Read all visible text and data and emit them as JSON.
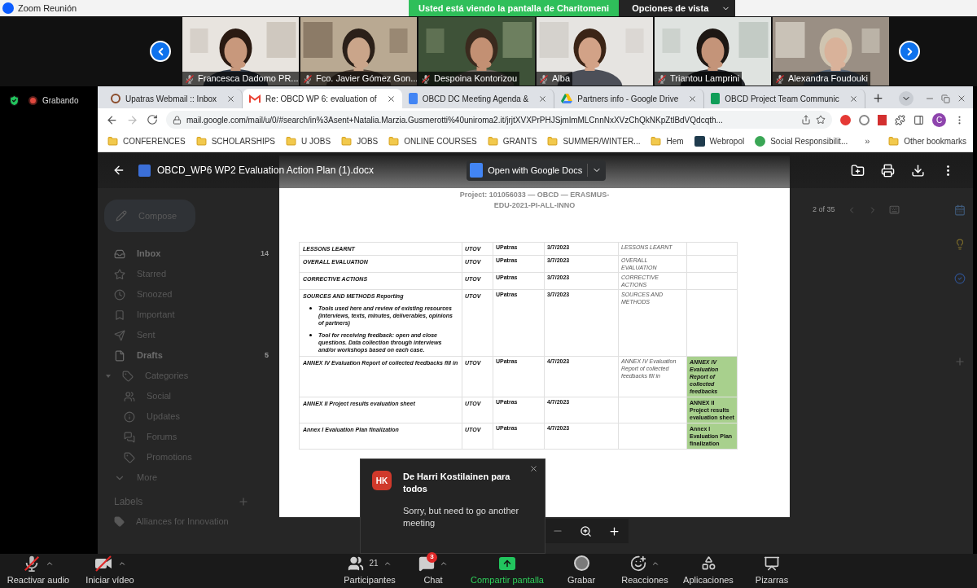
{
  "window": {
    "title": "Zoom Reunión"
  },
  "share_banner": {
    "text": "Usted está viendo la pantalla de Charitomeni",
    "view_options": "Opciones de vista"
  },
  "participants": [
    {
      "name": "Francesca Dadomo PR...",
      "muted": true
    },
    {
      "name": "Fco. Javier Gómez Gon...",
      "muted": true
    },
    {
      "name": "Despoina Kontorizou",
      "muted": true
    },
    {
      "name": "Alba",
      "muted": true
    },
    {
      "name": "Triantou Lamprini",
      "muted": true
    },
    {
      "name": "Alexandra Foudouki",
      "muted": true
    }
  ],
  "recording": {
    "label": "Grabando"
  },
  "browser": {
    "tabs": [
      {
        "title": "Upatras Webmail :: Inbox",
        "selected": false,
        "kind": "webmail"
      },
      {
        "title": "Re: OBCD WP 6: evaluation of",
        "selected": true,
        "kind": "gmail"
      },
      {
        "title": "OBCD DC Meeting Agenda &",
        "selected": false,
        "kind": "docs"
      },
      {
        "title": "Partners info - Google Drive",
        "selected": false,
        "kind": "drive"
      },
      {
        "title": "OBCD Project Team Communic",
        "selected": false,
        "kind": "sheets"
      }
    ],
    "url": "mail.google.com/mail/u/0/#search/in%3Asent+Natalia.Marzia.Gusmerotti%40uniroma2.it/jrjtXVXPrPHJSjmlmMLCnnNxXVzChQkNKpZtlBdVQdcqth...",
    "profile": "C",
    "bookmarks": [
      {
        "label": "CONFERENCES",
        "kind": "folder"
      },
      {
        "label": "SCHOLARSHIPS",
        "kind": "folder"
      },
      {
        "label": "U JOBS",
        "kind": "folder"
      },
      {
        "label": "JOBS",
        "kind": "folder"
      },
      {
        "label": "ONLINE COURSES",
        "kind": "folder"
      },
      {
        "label": "GRANTS",
        "kind": "folder"
      },
      {
        "label": "SUMMER/WINTER...",
        "kind": "folder"
      },
      {
        "label": "Hem",
        "kind": "folder"
      },
      {
        "label": "Webropol",
        "kind": "site"
      },
      {
        "label": "Social Responsibilit...",
        "kind": "site"
      }
    ],
    "more_bookmarks": "»",
    "other_bookmarks": "Other bookmarks"
  },
  "gmail": {
    "compose": "Compose",
    "folders": [
      {
        "label": "Inbox",
        "count": "14",
        "unread": true
      },
      {
        "label": "Starred",
        "unread": false
      },
      {
        "label": "Snoozed",
        "unread": false
      },
      {
        "label": "Important",
        "unread": false
      },
      {
        "label": "Sent",
        "unread": false
      },
      {
        "label": "Drafts",
        "count": "5",
        "unread": true
      },
      {
        "label": "Categories",
        "unread": false,
        "expanded": true,
        "children": [
          {
            "label": "Social",
            "unread": false
          },
          {
            "label": "Updates",
            "unread": false
          },
          {
            "label": "Forums",
            "unread": false
          },
          {
            "label": "Promotions",
            "unread": false
          }
        ]
      },
      {
        "label": "More",
        "unread": false
      }
    ],
    "labels_heading": "Labels",
    "labels": [
      {
        "label": "Alliances for Innovation"
      }
    ],
    "pager": "2 of 35"
  },
  "preview": {
    "filename": "OBCD_WP6 WP2 Evaluation Action Plan (1).docx",
    "open_with": "Open with Google Docs",
    "header": [
      "Project: 101056033 — OBCD — ERASMUS-",
      "EDU-2021-PI-ALL-INNO"
    ],
    "rows": [
      {
        "activity": "LESSONS LEARNT",
        "lead": "UTOV",
        "partner": "UPatras",
        "date": "3/7/2023",
        "note": "LESSONS LEARNT",
        "highlighted": false
      },
      {
        "activity": "OVERALL EVALUATION",
        "lead": "UTOV",
        "partner": "UPatras",
        "date": "3/7/2023",
        "note": "OVERALL EVALUATION",
        "highlighted": false
      },
      {
        "activity": "CORRECTIVE ACTIONS",
        "lead": "UTOV",
        "partner": "UPatras",
        "date": "3/7/2023",
        "note": "CORRECTIVE ACTIONS",
        "highlighted": false
      },
      {
        "activity": "SOURCES AND METHODS Reporting",
        "bullets": [
          "Tools used here and review of existing resources (interviews, texts, minutes, deliverables, opinions of partners)",
          "Tool for receiving feedback: open and close questions. Data collection through interviews and/or workshops based on each case."
        ],
        "lead": "UTOV",
        "partner": "UPatras",
        "date": "3/7/2023",
        "note": "SOURCES AND METHODS",
        "highlighted": false
      },
      {
        "activity": "ANNEX IV Evaluation Report of collected feedbacks fill in",
        "lead": "UTOV",
        "partner": "UPatras",
        "date": "4/7/2023",
        "note": "ANNEX IV Evaluation Report of collected feedbacks fill in",
        "output": "ANNEX IV Evaluation Report of collected feedbacks",
        "highlighted": true
      },
      {
        "activity": "ANNEX II Project results evaluation sheet",
        "lead": "UTOV",
        "partner": "UPatras",
        "date": "4/7/2023",
        "output": "ANNEX II Project results evaluation sheet",
        "highlighted": true
      },
      {
        "activity": "Annex I Evaluation Plan finalization",
        "lead": "UTOV",
        "partner": "UPatras",
        "date": "4/7/2023",
        "output": "Annex I Evaluation Plan finalization",
        "highlighted": true
      }
    ]
  },
  "chat_notification": {
    "initials": "HK",
    "title": "De Harri Kostilainen para todos",
    "message": "Sorry, but need to go another meeting"
  },
  "toolbar": [
    {
      "kind": "audio",
      "label": "Reactivar audio",
      "off": true
    },
    {
      "kind": "video",
      "label": "Iniciar vídeo",
      "off": true
    },
    {
      "kind": "participants",
      "label": "Participantes",
      "count": "21"
    },
    {
      "kind": "chat",
      "label": "Chat",
      "badge": "3"
    },
    {
      "kind": "share",
      "label": "Compartir pantalla"
    },
    {
      "kind": "record",
      "label": "Grabar"
    },
    {
      "kind": "reactions",
      "label": "Reacciones"
    },
    {
      "kind": "apps",
      "label": "Aplicaciones"
    },
    {
      "kind": "whiteboard",
      "label": "Pizarras"
    }
  ]
}
